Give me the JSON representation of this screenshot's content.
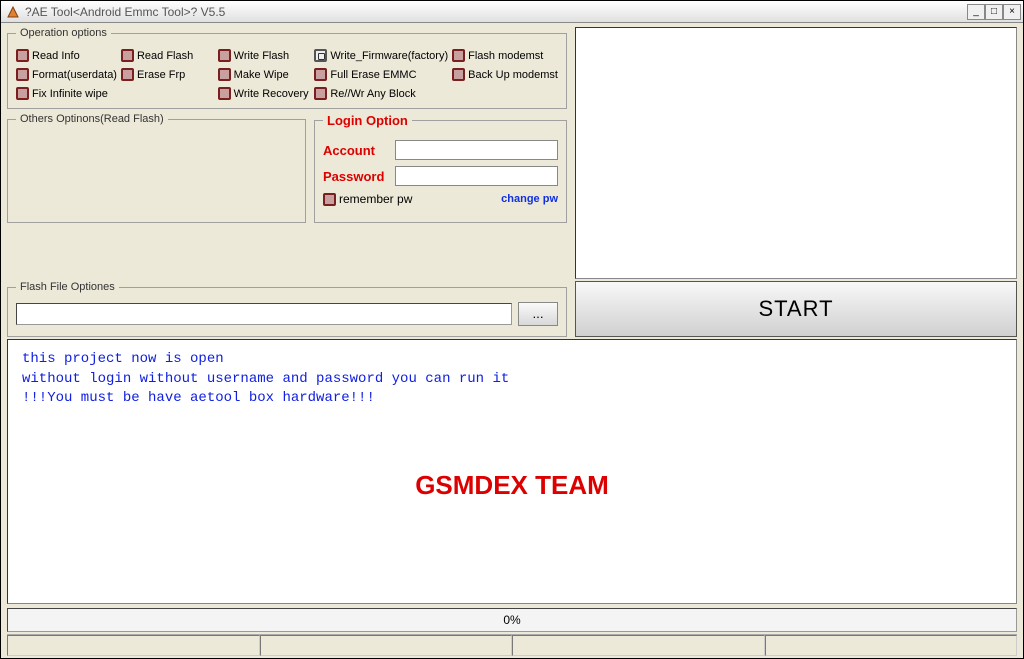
{
  "window": {
    "title": "?AE Tool<Android Emmc Tool>? V5.5"
  },
  "operations": {
    "legend": "Operation options",
    "items": [
      {
        "label": "Read Info",
        "selected": false
      },
      {
        "label": "Read Flash",
        "selected": false
      },
      {
        "label": "Write Flash",
        "selected": false
      },
      {
        "label": "Write_Firmware(factory)",
        "selected": true
      },
      {
        "label": "Flash modemst",
        "selected": false
      },
      {
        "label": "Format(userdata)",
        "selected": false
      },
      {
        "label": "Erase Frp",
        "selected": false
      },
      {
        "label": "Make Wipe",
        "selected": false
      },
      {
        "label": "Full Erase EMMC",
        "selected": false
      },
      {
        "label": "Back Up modemst",
        "selected": false
      },
      {
        "label": "Fix Infinite wipe",
        "selected": false
      },
      {
        "label": "",
        "selected": false
      },
      {
        "label": "Write Recovery",
        "selected": false
      },
      {
        "label": "Re//Wr Any Block",
        "selected": false
      }
    ]
  },
  "others": {
    "legend": "Others Optinons(Read Flash)"
  },
  "login": {
    "legend": "Login Option",
    "account_label": "Account",
    "account_value": "",
    "password_label": "Password",
    "password_value": "",
    "remember_label": "remember pw",
    "change_pw": "change pw"
  },
  "flash": {
    "legend": "Flash File Optiones",
    "path": "",
    "browse": "..."
  },
  "start_button": "START",
  "log": {
    "line1": "this project now is open",
    "line2": "without login without username and password you can run it",
    "line3": "!!!You must be have aetool box hardware!!!"
  },
  "watermark": "GSMDEX TEAM",
  "progress": "0%"
}
